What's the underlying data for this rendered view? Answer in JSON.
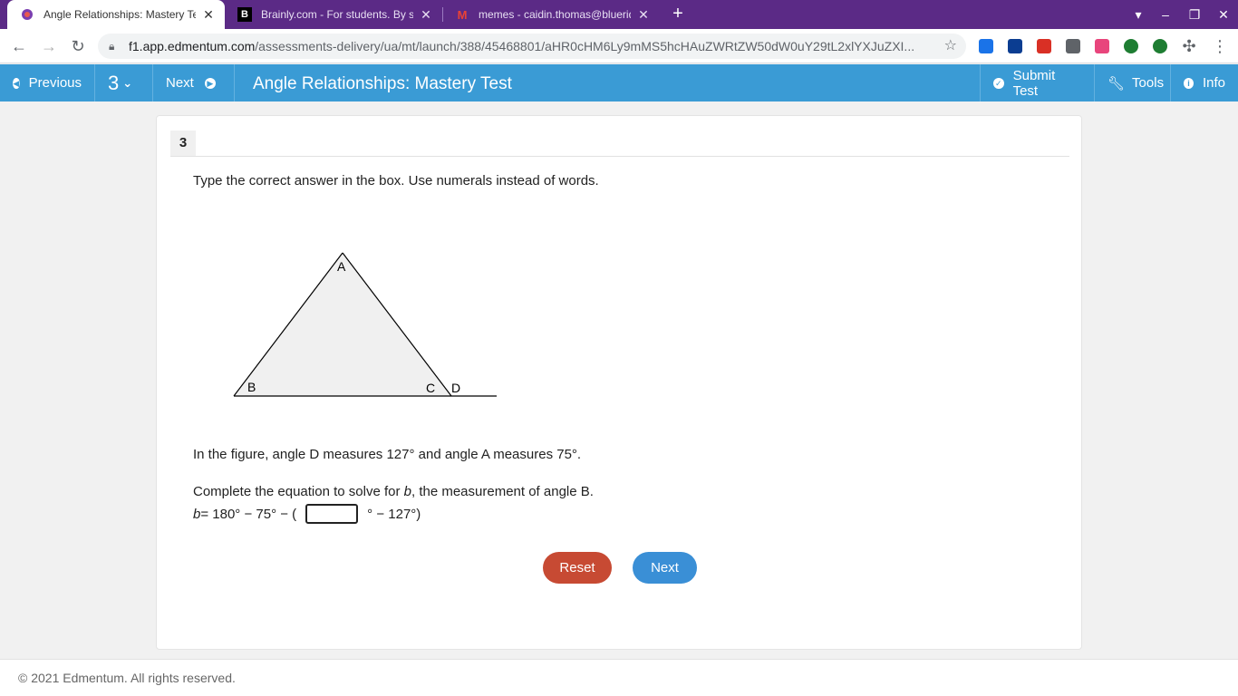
{
  "browser": {
    "tabs": [
      {
        "title": "Angle Relationships: Mastery Tes",
        "active": true
      },
      {
        "title": "Brainly.com - For students. By st",
        "active": false
      },
      {
        "title": "memes - caidin.thomas@bluerid",
        "active": false
      }
    ],
    "new_tab": "+",
    "close_glyph": "✕",
    "url_host": "f1.app.edmentum.com",
    "url_path": "/assessments-delivery/ua/mt/launch/388/45468801/aHR0cHM6Ly9mMS5hcHAuZWRtZW50dW0uY29tL2xlYXJuZXI..."
  },
  "appbar": {
    "previous": "Previous",
    "question_selector": "3",
    "next": "Next",
    "title": "Angle Relationships: Mastery Test",
    "submit": "Submit Test",
    "tools": "Tools",
    "info": "Info"
  },
  "question": {
    "number": "3",
    "instruction": "Type the correct answer in the box. Use numerals instead of words.",
    "figure_labels": {
      "a": "A",
      "b": "B",
      "c": "C",
      "d": "D"
    },
    "statement": "In the figure, angle D measures 127° and angle A measures 75°.",
    "prompt_prefix": "Complete the equation to solve for ",
    "prompt_var": "b",
    "prompt_suffix": ", the measurement of angle B.",
    "eq_var": "b",
    "eq_left": " = 180° − 75° − (",
    "eq_right": "° − 127°)",
    "answer_value": ""
  },
  "buttons": {
    "reset": "Reset",
    "next": "Next"
  },
  "footer": {
    "copyright": "© 2021 Edmentum. All rights reserved."
  },
  "colors": {
    "tabbar": "#5b2a86",
    "appbar": "#3a9bd5",
    "reset": "#c74a33",
    "next": "#3a8fd6"
  }
}
